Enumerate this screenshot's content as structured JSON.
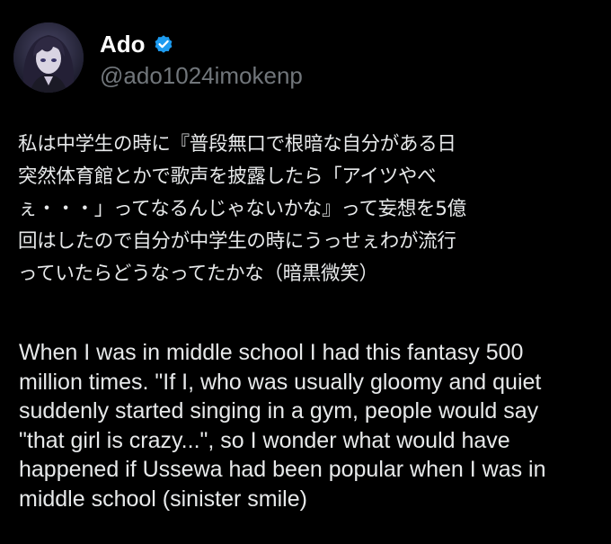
{
  "tweet": {
    "author": {
      "display_name": "Ado",
      "handle": "@ado1024imokenp",
      "verified_icon": "verified-badge-icon",
      "verified_color": "#1d9bf0"
    },
    "text_ja_lines": [
      "私は中学生の時に『普段無口で根暗な自分がある日",
      "突然体育館とかで歌声を披露したら「アイツやべ",
      "ぇ・・・」ってなるんじゃないかな』って妄想を5億",
      "回はしたので自分が中学生の時にうっせぇわが流行",
      "っていたらどうなってたかな（暗黒微笑）"
    ],
    "translation_lines": [
      "When I was in middle school I had this fantasy 500",
      "million times. \"If I, who was usually gloomy and quiet",
      "suddenly started singing in a gym, people would say",
      "\"that girl is crazy...\", so I wonder what would have",
      "happened if Ussewa had been popular when I was in",
      "middle school (sinister smile)"
    ]
  }
}
